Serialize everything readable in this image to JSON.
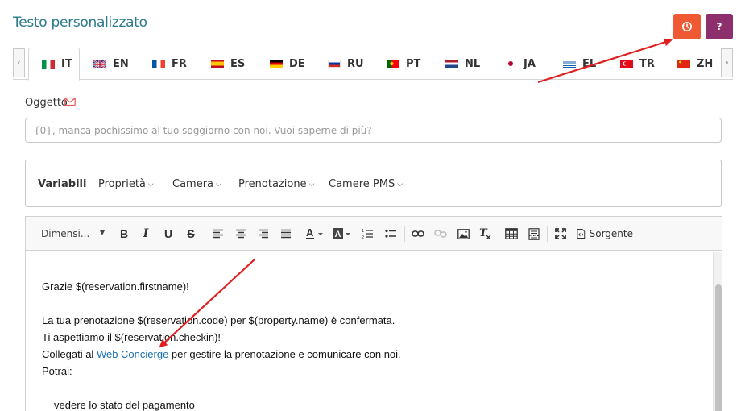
{
  "page": {
    "title": "Testo personalizzato"
  },
  "buttons": {
    "history_icon": "history-icon",
    "help_label": "?"
  },
  "tabs": [
    {
      "code": "IT",
      "flag": "italy"
    },
    {
      "code": "EN",
      "flag": "uk"
    },
    {
      "code": "FR",
      "flag": "france"
    },
    {
      "code": "ES",
      "flag": "spain"
    },
    {
      "code": "DE",
      "flag": "germany"
    },
    {
      "code": "RU",
      "flag": "russia"
    },
    {
      "code": "PT",
      "flag": "portugal"
    },
    {
      "code": "NL",
      "flag": "netherlands"
    },
    {
      "code": "JA",
      "flag": "japan"
    },
    {
      "code": "EL",
      "flag": "greece"
    },
    {
      "code": "TR",
      "flag": "turkey"
    },
    {
      "code": "ZH",
      "flag": "china"
    }
  ],
  "subject": {
    "label": "Oggetto",
    "placeholder": "{0}, manca pochissimo al tuo soggiorno con noi. Vuoi saperne di più?"
  },
  "variables": {
    "title": "Variabili",
    "menus": [
      "Proprietà",
      "Camera",
      "Prenotazione",
      "Camere PMS"
    ]
  },
  "toolbar": {
    "size_label": "Dimensi...",
    "source_label": "Sorgente"
  },
  "editor": {
    "line1": "Grazie $(reservation.firstname)!",
    "line2": "La tua prenotazione $(reservation.code) per $(property.name) è confermata.",
    "line3": "Ti aspettiamo il $(reservation.checkin)!",
    "line4_before": "Collegati al ",
    "line4_link": "Web Concierge",
    "line4_after": " per gestire la prenotazione e comunicare con noi.",
    "line5": "Potrai:",
    "line6": "vedere lo stato del pagamento"
  },
  "colors": {
    "accent_teal": "#2c7a8c",
    "history_button": "#ef5a34",
    "help_button": "#8c2f6c",
    "arrow_red": "#e02020",
    "link": "#1a6fb0"
  }
}
